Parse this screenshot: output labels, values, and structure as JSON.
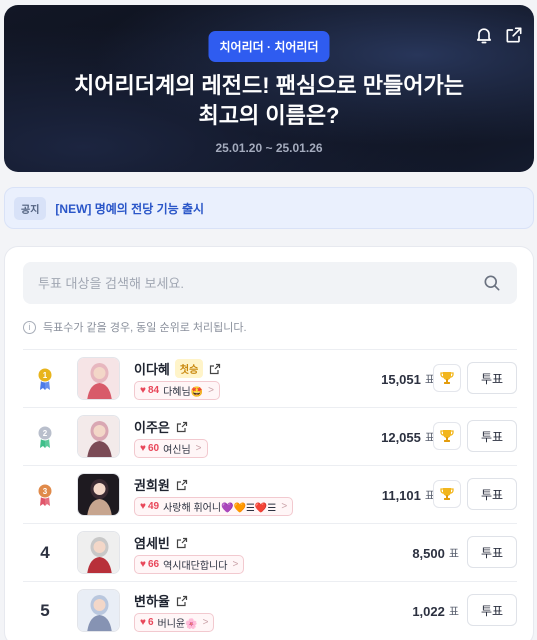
{
  "hero": {
    "category": "치어리더 · 치어리더",
    "title": "치어리더계의 레전드! 팬심으로 만들어가는\n최고의 이름은?",
    "period": "25.01.20 ~ 25.01.26"
  },
  "notice": {
    "badge": "공지",
    "text": "[NEW] 명예의 전당 기능 출시"
  },
  "search": {
    "placeholder": "투표 대상을 검색해 보세요."
  },
  "hint": "득표수가 같을 경우, 동일 순위로 처리됩니다.",
  "vote_label": "투표",
  "unit": "표",
  "rows": [
    {
      "rank": "1",
      "name": "이다혜",
      "badge": "첫승",
      "level": "84",
      "fan": "다혜님🤩",
      "votes": "15,051",
      "medal_color": "#e8b41c",
      "ribbon": "#4c7be8"
    },
    {
      "rank": "2",
      "name": "이주은",
      "badge": "",
      "level": "60",
      "fan": "여신님",
      "votes": "12,055",
      "medal_color": "#b9bfcc",
      "ribbon": "#3fbf8a"
    },
    {
      "rank": "3",
      "name": "권희원",
      "badge": "",
      "level": "49",
      "fan": "사랑해 휘어니💜🧡☰❤️☰",
      "votes": "11,101",
      "medal_color": "#e08a4a",
      "ribbon": "#e0566a"
    },
    {
      "rank": "4",
      "name": "염세빈",
      "badge": "",
      "level": "66",
      "fan": "역시대단합니다",
      "votes": "8,500"
    },
    {
      "rank": "5",
      "name": "변하율",
      "badge": "",
      "level": "6",
      "fan": "버니윤🌸",
      "votes": "1,022"
    }
  ]
}
